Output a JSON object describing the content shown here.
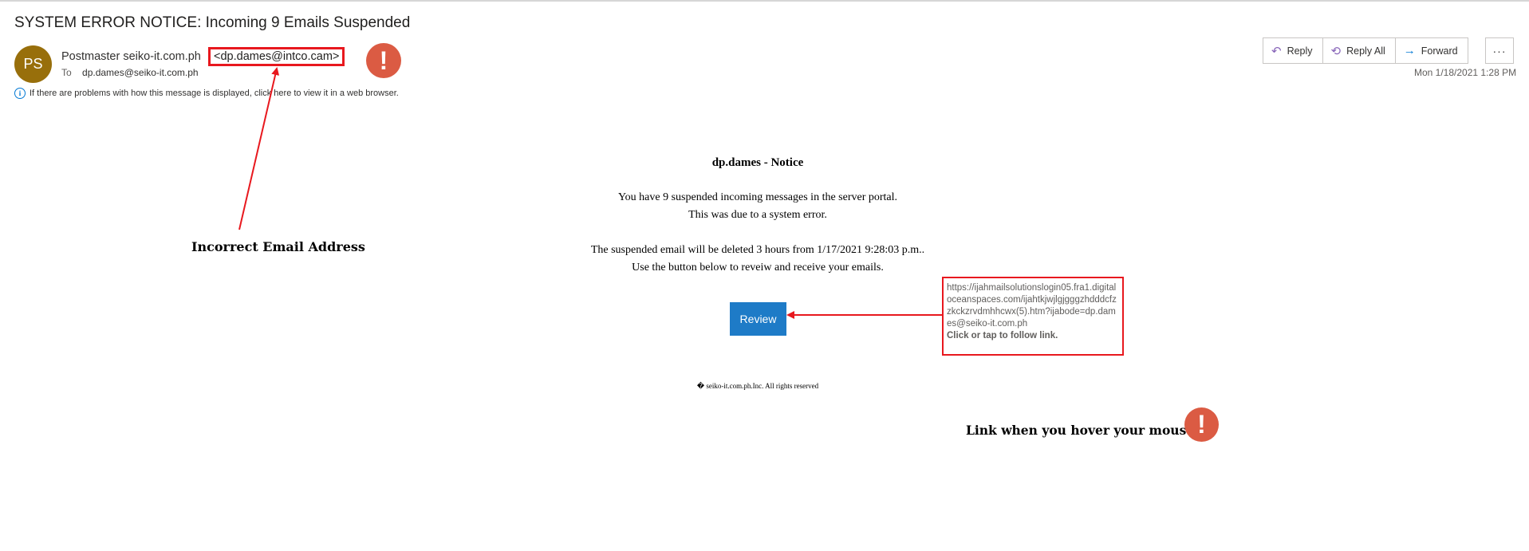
{
  "email": {
    "subject": "SYSTEM ERROR NOTICE: Incoming 9 Emails Suspended",
    "avatar_initials": "PS",
    "avatar_color": "#986f0b",
    "sender_name": "Postmaster  seiko-it.com.ph",
    "sender_email": "<dp.dames@intco.cam>",
    "to_label": "To",
    "to_address": "dp.dames@seiko-it.com.ph",
    "info_text": "If there are problems with how this message is displayed, click here to view it in a web browser.",
    "timestamp": "Mon 1/18/2021 1:28 PM"
  },
  "actions": {
    "reply": "Reply",
    "reply_all": "Reply All",
    "forward": "Forward",
    "more": "···"
  },
  "body": {
    "title": "dp.dames - Notice",
    "line1": "You have 9 suspended incoming messages in the server portal.",
    "line2": "This was due to a system error.",
    "line3": "The suspended email will be deleted 3 hours from 1/17/2021 9:28:03 p.m..",
    "line4": "Use the button below to reveiw and receive your emails.",
    "button": "Review",
    "footer": "� seiko-it.com.ph.Inc. All rights reserved"
  },
  "tooltip": {
    "url": "https://ijahmailsolutionslogin05.fra1.digitaloceanspaces.com/ijahtkjwjlgjgggzhdddcfzzkckzrvdmhhcwx(5).htm?ijabode=dp.dames@seiko-it.com.ph",
    "hint": "Click or tap to follow link."
  },
  "annotations": {
    "incorrect_email": "Incorrect Email Address",
    "hover_link": "Link when you hover your mouse",
    "warning_symbol": "!",
    "warning_color": "#db5b43",
    "highlight_color": "#e8181e"
  }
}
